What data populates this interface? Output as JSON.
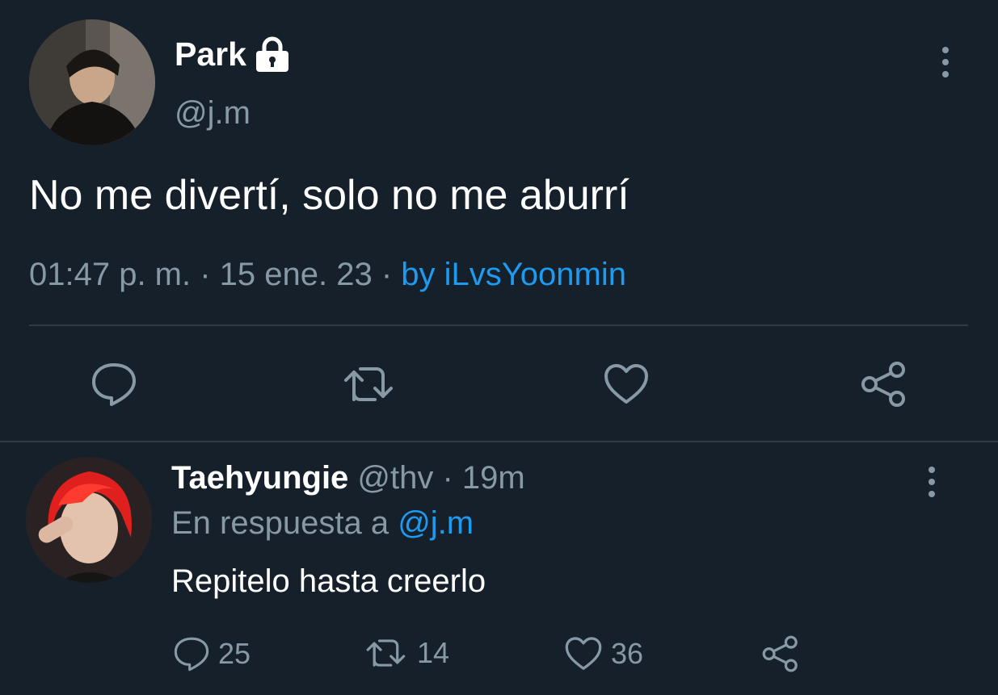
{
  "tweet": {
    "display_name": "Park",
    "handle": "@j.m",
    "text": "No me divertí, solo no me aburrí",
    "meta_time_date": "01:47 p. m. · 15 ene. 23 ·",
    "meta_source": "by iLvsYoonmin"
  },
  "reply": {
    "display_name": "Taehyungie",
    "handle_time": "@thv · 19m",
    "reply_to_prefix": "En respuesta a",
    "reply_to_handle": "@j.m",
    "text": "Repitelo hasta creerlo",
    "counts": {
      "replies": "25",
      "retweets": "14",
      "likes": "36"
    }
  },
  "colors": {
    "background": "#15202b",
    "muted": "#8899a6",
    "link": "#1d9bf0",
    "divider": "#2f3b47"
  },
  "icons": [
    "lock-icon",
    "more-icon",
    "reply-icon",
    "retweet-icon",
    "like-icon",
    "share-icon"
  ]
}
